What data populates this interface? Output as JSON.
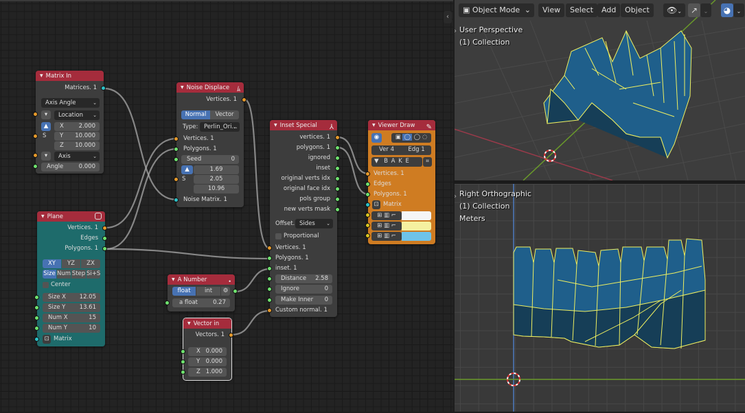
{
  "node_editor": {
    "nodes": {
      "matrix_in": {
        "title": "Matrix In",
        "output": "Matrices. 1",
        "mode": "Axis Angle",
        "location_label": "Location",
        "s_label": "S",
        "x_label": "X",
        "x_value": "2.000",
        "y_label": "Y",
        "y_value": "10.000",
        "z_label": "Z",
        "z_value": "10.000",
        "axis_label": "Axis",
        "angle_label": "Angle",
        "angle_value": "0.000"
      },
      "noise_displace": {
        "title": "Noise Displace",
        "output": "Vertices. 1",
        "mode_normal": "Normal",
        "mode_vector": "Vector",
        "type_label": "Type:",
        "type_value": "Perlin_Ori...",
        "in_vertices": "Vertices. 1",
        "in_polygons": "Polygons. 1",
        "seed_label": "Seed",
        "seed_value": "0",
        "s_label": "S",
        "v1": "1.69",
        "v2": "2.05",
        "v3": "10.96",
        "in_matrix": "Noise Matrix. 1"
      },
      "inset_special": {
        "title": "Inset Special",
        "outputs": [
          "vertices. 1",
          "polygons. 1",
          "ignored",
          "inset",
          "original verts idx",
          "original face idx",
          "pols group",
          "new verts mask"
        ],
        "offset_label": "Offset...",
        "offset_value": "Sides",
        "proportional_label": "Proportional",
        "in_vertices": "Vertices. 1",
        "in_polygons": "Polygons. 1",
        "in_inset": "inset. 1",
        "distance_label": "Distance",
        "distance_value": "2.58",
        "ignore_label": "Ignore",
        "ignore_value": "0",
        "make_inner_label": "Make Inner",
        "make_inner_value": "0",
        "in_custom_normal": "Custom normal. 1"
      },
      "viewer_draw": {
        "title": "Viewer Draw",
        "ver_label": "Ver",
        "ver_value": "4",
        "edg_label": "Edg",
        "edg_value": "1",
        "bake_label": "B A K E",
        "in_vertices": "Vertices. 1",
        "in_edges": "Edges",
        "in_polygons": "Polygons. 1",
        "in_matrix": "Matrix",
        "colors": [
          "#f5f5f5",
          "#f5f0a0",
          "#6ec3ea"
        ]
      },
      "plane": {
        "title": "Plane",
        "out_vertices": "Vertices. 1",
        "out_edges": "Edges",
        "out_polygons": "Polygons. 1",
        "planes": [
          "XY",
          "YZ",
          "ZX"
        ],
        "modes": [
          "Size",
          "Num",
          "Step",
          "Si+S"
        ],
        "center_label": "Center",
        "size_x_label": "Size X",
        "size_x_value": "12.05",
        "size_y_label": "Size Y",
        "size_y_value": "13.61",
        "num_x_label": "Num X",
        "num_x_value": "15",
        "num_y_label": "Num Y",
        "num_y_value": "10",
        "matrix_label": "Matrix"
      },
      "a_number": {
        "title": "A Number",
        "float_label": "float",
        "int_label": "int",
        "value_label": "a float",
        "value": "0.27"
      },
      "vector_in": {
        "title": "Vector in",
        "output": "Vectors. 1",
        "x_label": "X",
        "x_value": "0.000",
        "y_label": "Y",
        "y_value": "0.000",
        "z_label": "Z",
        "z_value": "1.000"
      }
    }
  },
  "viewport_header": {
    "mode": "Object Mode",
    "menus": [
      "View",
      "Select",
      "Add",
      "Object"
    ]
  },
  "viewport_top": {
    "view_name": "User Perspective",
    "collection": "(1) Collection"
  },
  "viewport_bottom": {
    "view_name": "Right Orthographic",
    "collection": "(1) Collection",
    "units": "Meters"
  },
  "colors": {
    "node_header": "#a52c3c",
    "plane_body": "#1e6b6b",
    "viewer_body": "#cf7c22",
    "mesh_edge": "#f0f060",
    "mesh_face": "#1f5f8b",
    "accent": "#4772b3"
  }
}
